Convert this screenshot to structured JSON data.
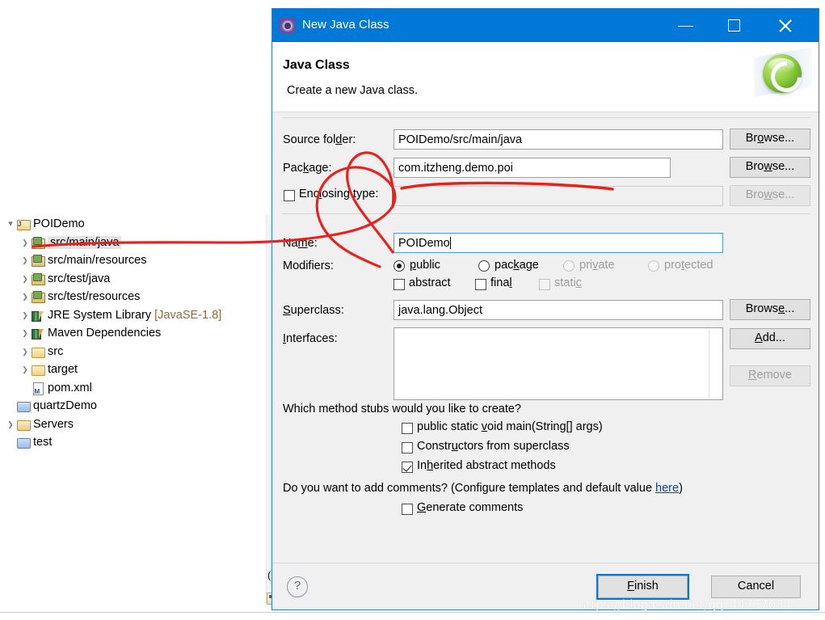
{
  "window": {
    "title": "New Java Class",
    "icon": "java-class-wizard-icon",
    "minimize": "",
    "maximize": "",
    "close": ""
  },
  "header": {
    "title": "Java Class",
    "subtitle": "Create a new Java class.",
    "badge_icon": "green-c-badge-icon"
  },
  "form": {
    "source_folder": {
      "label_pre": "Source fol",
      "label_mn": "d",
      "label_post": "er:",
      "value": "POIDemo/src/main/java",
      "browse": {
        "pre": "Br",
        "mn": "o",
        "post": "wse..."
      }
    },
    "package": {
      "label_pre": "Pac",
      "label_mn": "k",
      "label_post": "age:",
      "value": "com.itzheng.demo.poi",
      "browse": {
        "pre": "Bro",
        "mn": "w",
        "post": "se..."
      }
    },
    "enclosing_type": {
      "label_pre": "Enc",
      "label_mn": "l",
      "label_post": "osing type:",
      "checked": false,
      "value": "",
      "browse": {
        "pre": "Bro",
        "mn": "w",
        "post": "se..."
      },
      "disabled": true
    },
    "name": {
      "label_pre": "Na",
      "label_mn": "m",
      "label_post": "e:",
      "value": "POIDemo"
    },
    "modifiers": {
      "label": "Modifiers:",
      "radios": [
        {
          "pre": "",
          "mn": "p",
          "post": "ublic",
          "selected": true,
          "disabled": false
        },
        {
          "pre": "pac",
          "mn": "k",
          "post": "age",
          "selected": false,
          "disabled": false
        },
        {
          "pre": "pri",
          "mn": "v",
          "post": "ate",
          "selected": false,
          "disabled": true
        },
        {
          "pre": "pro",
          "mn": "t",
          "post": "ected",
          "selected": false,
          "disabled": true
        }
      ],
      "checks": [
        {
          "pre": "abstract",
          "mn": "",
          "post": "",
          "checked": false,
          "disabled": false
        },
        {
          "pre": "fina",
          "mn": "l",
          "post": "",
          "checked": false,
          "disabled": false
        },
        {
          "pre": "stati",
          "mn": "c",
          "post": "",
          "checked": false,
          "disabled": true
        }
      ]
    },
    "superclass": {
      "label_pre": "",
      "label_mn": "S",
      "label_post": "uperclass:",
      "value": "java.lang.Object",
      "browse": {
        "pre": "Brows",
        "mn": "e",
        "post": "..."
      }
    },
    "interfaces": {
      "label_pre": "",
      "label_mn": "I",
      "label_post": "nterfaces:",
      "items": [],
      "add": {
        "pre": "",
        "mn": "A",
        "post": "dd..."
      },
      "remove": {
        "pre": "",
        "mn": "R",
        "post": "emove"
      }
    },
    "stubs_question": "Which method stubs would you like to create?",
    "stubs": [
      {
        "pre": "public static ",
        "mn": "v",
        "post": "oid main(String[] args)",
        "checked": false
      },
      {
        "pre": "Constr",
        "mn": "u",
        "post": "ctors from superclass",
        "checked": false
      },
      {
        "pre": "In",
        "mn": "h",
        "post": "erited abstract methods",
        "checked": true
      }
    ],
    "comments_question_pre": "Do you want to add comments? (Configure templates and default value ",
    "comments_link": "here",
    "comments_question_post": ")",
    "comments_check": {
      "pre": "",
      "mn": "G",
      "post": "enerate comments",
      "checked": false
    }
  },
  "footer": {
    "help_icon": "help-question-icon",
    "finish": {
      "pre": "",
      "mn": "F",
      "post": "inish"
    },
    "cancel": "Cancel"
  },
  "explorer": {
    "items": [
      {
        "label": "POIDemo",
        "icon": "java-project-icon",
        "twisty": "open",
        "indent": 0,
        "selected": false,
        "dim": ""
      },
      {
        "label": "src/main/java",
        "icon": "source-folder-icon",
        "twisty": "closed",
        "indent": 1,
        "selected": true,
        "dim": ""
      },
      {
        "label": "src/main/resources",
        "icon": "source-folder-icon",
        "twisty": "closed",
        "indent": 1,
        "selected": false,
        "dim": ""
      },
      {
        "label": "src/test/java",
        "icon": "source-folder-icon",
        "twisty": "closed",
        "indent": 1,
        "selected": false,
        "dim": ""
      },
      {
        "label": "src/test/resources",
        "icon": "source-folder-icon",
        "twisty": "closed",
        "indent": 1,
        "selected": false,
        "dim": ""
      },
      {
        "label": "JRE System Library ",
        "icon": "library-icon",
        "twisty": "closed",
        "indent": 1,
        "selected": false,
        "dim": "[JavaSE-1.8]"
      },
      {
        "label": "Maven Dependencies",
        "icon": "maven-dependencies-icon",
        "twisty": "closed",
        "indent": 1,
        "selected": false,
        "dim": ""
      },
      {
        "label": "src",
        "icon": "folder-icon",
        "twisty": "closed",
        "indent": 1,
        "selected": false,
        "dim": ""
      },
      {
        "label": "target",
        "icon": "folder-icon",
        "twisty": "closed",
        "indent": 1,
        "selected": false,
        "dim": ""
      },
      {
        "label": "pom.xml",
        "icon": "xml-file-icon",
        "twisty": "none",
        "indent": 1,
        "selected": false,
        "dim": ""
      },
      {
        "label": "quartzDemo",
        "icon": "closed-project-icon",
        "twisty": "none",
        "indent": 0,
        "selected": false,
        "dim": ""
      },
      {
        "label": "Servers",
        "icon": "servers-folder-icon",
        "twisty": "closed",
        "indent": 0,
        "selected": false,
        "dim": ""
      },
      {
        "label": "test",
        "icon": "closed-project-icon",
        "twisty": "none",
        "indent": 0,
        "selected": false,
        "dim": ""
      }
    ]
  },
  "watermark": "https://blog.csdn.net/qq_44757034",
  "annotation": {
    "color": "#e8211c",
    "shape": "red-handdrawn-marker"
  },
  "colors": {
    "title_bar": "#0078d7",
    "dialog_bg": "#f0f0f0",
    "accent": "#0078d7",
    "annotation_red": "#e8211c",
    "link": "#0645ad",
    "selection": "#e4e4e4"
  }
}
